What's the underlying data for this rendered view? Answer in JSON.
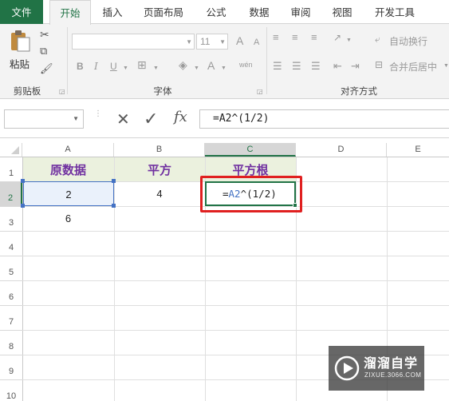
{
  "menu": {
    "tabs": [
      "文件",
      "开始",
      "插入",
      "页面布局",
      "公式",
      "数据",
      "审阅",
      "视图",
      "开发工具"
    ],
    "active": "开始"
  },
  "ribbon": {
    "clipboard": {
      "paste_label": "粘贴",
      "group_label": "剪贴板"
    },
    "font": {
      "size_value": "11",
      "bold": "B",
      "italic": "I",
      "underline": "U",
      "font_color_glyph": "A",
      "phonetic_glyph": "wén",
      "grow_glyph": "A",
      "shrink_glyph": "A",
      "group_label": "字体"
    },
    "alignment": {
      "wrap_text": "自动换行",
      "merge_center": "合并后居中",
      "group_label": "对齐方式"
    }
  },
  "formula_bar": {
    "name_box": "",
    "cancel_glyph": "✕",
    "enter_glyph": "✓",
    "fx_glyph": "fx",
    "content": "=A2^(1/2)"
  },
  "sheet": {
    "columns": [
      "A",
      "B",
      "C",
      "D",
      "E"
    ],
    "rows": [
      "1",
      "2",
      "3",
      "4",
      "5",
      "6",
      "7",
      "8",
      "9",
      "10"
    ],
    "cells": {
      "A1": "原数据",
      "B1": "平方",
      "C1": "平方根",
      "A2": "2",
      "B2": "4",
      "C2_prefix": "=",
      "C2_ref": "A2",
      "C2_suffix": "^(1/2)",
      "A3": "6"
    },
    "active_cell": "C2",
    "ref_color": "#4472c4",
    "header_color": "#7030a0",
    "header_fill": "#ebf1de",
    "highlight_color": "#e02020"
  },
  "watermark": {
    "brand": "溜溜自学",
    "url": "ZIXUE.3066.COM"
  },
  "colors": {
    "accent": "#217346"
  }
}
